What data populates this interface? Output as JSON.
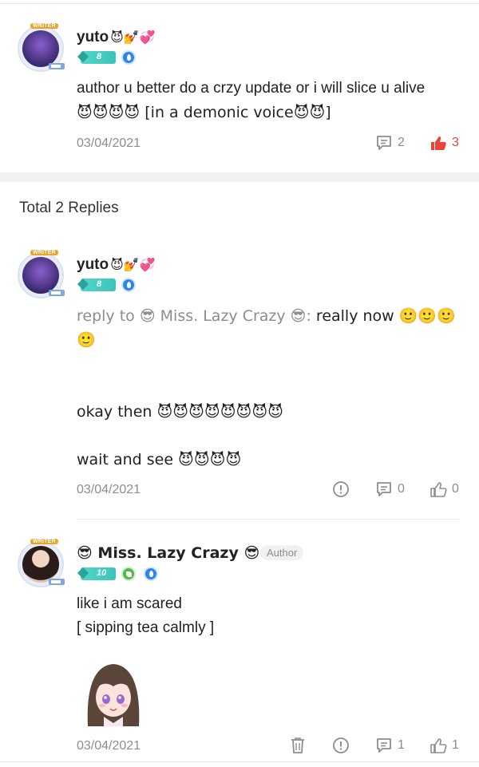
{
  "comment": {
    "username": "yuto",
    "username_emojis": "😈💅💞",
    "level": "8",
    "text_line1": "author u better do  a crzy update or i will slice u alive",
    "text_line2": "😈😈😈😈 [in a demonic voice😈😈]",
    "date": "03/04/2021",
    "reply_count": "2",
    "like_count": "3"
  },
  "replies_header": "Total 2 Replies",
  "reply1": {
    "username": "yuto",
    "username_emojis": "😈💅💞",
    "level": "8",
    "reply_prefix": "reply to 😎 Miss. Lazy Crazy 😎:",
    "reply_text": " really now 🙂🙂🙂",
    "reply_text_line2": "🙂",
    "line3": "okay then 😈😈😈😈😈😈😈😈",
    "line4": "wait and see 😈😈😈😈",
    "date": "03/04/2021",
    "reply_count": "0",
    "like_count": "0"
  },
  "reply2": {
    "username": "😎 Miss. Lazy Crazy 😎",
    "author_tag": "Author",
    "level": "10",
    "line1": "like i am scared",
    "line2": "[ sipping tea calmly ]",
    "date": "03/04/2021",
    "reply_count": "1",
    "like_count": "1"
  },
  "colors": {
    "liked": "#e8453c",
    "muted": "#8d8d8d",
    "level_badge": "#47cfc3",
    "blue_badge": "#2f87e3"
  },
  "icons": {
    "comment": "speech-bubble-icon",
    "like": "thumbs-up-icon",
    "report": "exclamation-circle-icon",
    "delete": "trash-icon"
  }
}
